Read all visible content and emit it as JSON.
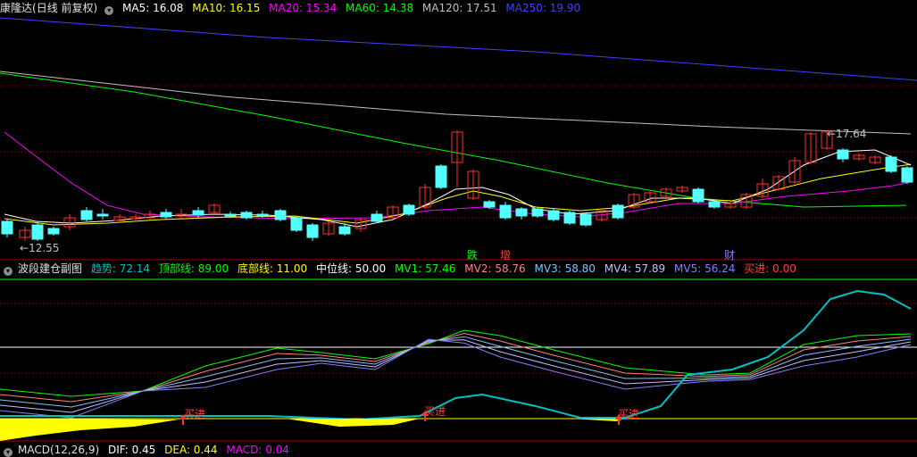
{
  "main_chart": {
    "stock_name": "康隆达",
    "period_label": "(日线 前复权)",
    "ma": [
      {
        "label": "MA5: 16.08",
        "color": "#ffffff"
      },
      {
        "label": "MA10: 16.15",
        "color": "#ffff00"
      },
      {
        "label": "MA20: 15.34",
        "color": "#ff00ff"
      },
      {
        "label": "MA60: 14.38",
        "color": "#00ff00"
      },
      {
        "label": "MA120: 17.51",
        "color": "#c0c0c0"
      },
      {
        "label": "MA250: 19.90",
        "color": "#4040ff"
      }
    ],
    "high_label": "17.64",
    "low_label": "12.55",
    "markers": [
      {
        "text": "跌",
        "color": "#00ff00"
      },
      {
        "text": "增",
        "color": "#ff4040"
      },
      {
        "text": "财",
        "color": "#8080ff"
      }
    ]
  },
  "sub_chart": {
    "title": "波段建仓副图",
    "indicators": [
      {
        "label": "趋势: 72.14",
        "color": "#00c0c0"
      },
      {
        "label": "顶部线: 89.00",
        "color": "#00ff00"
      },
      {
        "label": "底部线: 11.00",
        "color": "#ffff00"
      },
      {
        "label": "中位线: 50.00",
        "color": "#ffffff"
      },
      {
        "label": "MV1: 57.46",
        "color": "#00ff00"
      },
      {
        "label": "MV2: 58.76",
        "color": "#ff8080"
      },
      {
        "label": "MV3: 58.80",
        "color": "#80c0ff"
      },
      {
        "label": "MV4: 57.89",
        "color": "#c0c0ff"
      },
      {
        "label": "MV5: 56.24",
        "color": "#8080ff"
      },
      {
        "label": "买进: 0.00",
        "color": "#ff4040"
      }
    ],
    "buy_labels": [
      "买进",
      "买进",
      "买进"
    ]
  },
  "macd": {
    "title": "MACD(12,26,9)",
    "dif": "DIF: 0.45",
    "dea": "DEA: 0.44",
    "macd": "MACD: 0.04"
  },
  "colors": {
    "up": "#ff3030",
    "down": "#54ffff",
    "grid": "#a00000"
  }
}
